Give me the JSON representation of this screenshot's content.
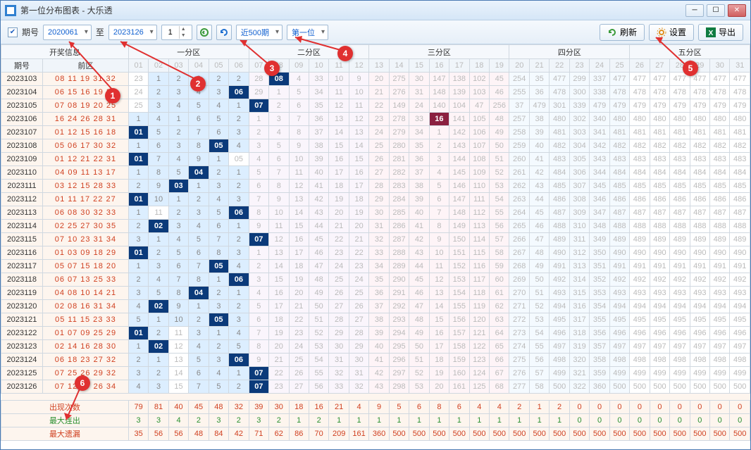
{
  "title": "第一位分布图表 - 大乐透",
  "toolbar": {
    "issue_label": "期号",
    "from": "2020061",
    "to_label": "至",
    "to": "2023126",
    "step": "1",
    "range": "近500期",
    "pos": "第一位",
    "refresh": "刷新",
    "settings": "设置",
    "export": "导出"
  },
  "header": {
    "info": "开奖信息",
    "zones": [
      "一分区",
      "二分区",
      "三分区",
      "四分区",
      "五分区"
    ],
    "issue": "期号",
    "front": "前区",
    "nums": [
      "01",
      "02",
      "03",
      "04",
      "05",
      "06",
      "07",
      "08",
      "09",
      "10",
      "11",
      "12",
      "13",
      "14",
      "15",
      "16",
      "17",
      "18",
      "19",
      "20",
      "21",
      "22",
      "23",
      "24",
      "25",
      "26",
      "27",
      "28",
      "29",
      "30",
      "31"
    ]
  },
  "rows": [
    {
      "issue": "2023103",
      "front": "08 11 19 31 32",
      "hit": 8,
      "vals": [
        23,
        1,
        2,
        3,
        2,
        2,
        28,
        "08",
        4,
        33,
        10,
        9,
        20,
        275,
        30,
        147,
        138,
        102,
        45,
        254,
        35,
        477,
        299,
        337,
        477,
        477,
        477,
        477,
        477,
        477,
        477
      ]
    },
    {
      "issue": "2023104",
      "front": "06 15 16 19 33",
      "hit": 6,
      "vals": [
        24,
        2,
        3,
        4,
        3,
        "06",
        29,
        1,
        5,
        34,
        11,
        10,
        21,
        276,
        31,
        148,
        139,
        103,
        46,
        255,
        36,
        478,
        300,
        338,
        478,
        478,
        478,
        478,
        478,
        478,
        478
      ]
    },
    {
      "issue": "2023105",
      "front": "07 08 19 20 25",
      "hit": 7,
      "vals": [
        25,
        3,
        4,
        5,
        4,
        1,
        "07",
        2,
        6,
        35,
        12,
        11,
        22,
        149,
        24,
        140,
        104,
        47,
        256,
        37,
        479,
        301,
        339,
        479,
        479,
        479,
        479,
        479,
        479,
        479,
        479
      ]
    },
    {
      "issue": "2023106",
      "front": "16 24 26 28 31",
      "hit": 16,
      "hit2": true,
      "vals": [
        1,
        4,
        1,
        6,
        5,
        2,
        1,
        3,
        7,
        36,
        13,
        12,
        23,
        278,
        33,
        "16",
        141,
        105,
        48,
        257,
        38,
        480,
        302,
        340,
        480,
        480,
        480,
        480,
        480,
        480,
        480
      ]
    },
    {
      "issue": "2023107",
      "front": "01 12 15 16 18",
      "hit": 1,
      "vals": [
        "01",
        5,
        2,
        7,
        6,
        3,
        2,
        4,
        8,
        37,
        14,
        13,
        24,
        279,
        34,
        1,
        142,
        106,
        49,
        258,
        39,
        481,
        303,
        341,
        481,
        481,
        481,
        481,
        481,
        481,
        481
      ]
    },
    {
      "issue": "2023108",
      "front": "05 06 17 30 32",
      "hit": 5,
      "vals": [
        1,
        6,
        3,
        8,
        "05",
        4,
        3,
        5,
        9,
        38,
        15,
        14,
        25,
        280,
        35,
        2,
        143,
        107,
        50,
        259,
        40,
        482,
        304,
        342,
        482,
        482,
        482,
        482,
        482,
        482,
        482
      ]
    },
    {
      "issue": "2023109",
      "front": "01 12 21 22 31",
      "hit": 1,
      "vals": [
        "01",
        7,
        4,
        9,
        1,
        "05",
        4,
        6,
        10,
        39,
        16,
        15,
        26,
        281,
        36,
        3,
        144,
        108,
        51,
        260,
        41,
        483,
        305,
        343,
        483,
        483,
        483,
        483,
        483,
        483,
        483
      ]
    },
    {
      "issue": "2023110",
      "front": "04 09 11 13 17",
      "hit": 4,
      "vals": [
        1,
        8,
        5,
        "04",
        2,
        1,
        5,
        7,
        11,
        40,
        17,
        16,
        27,
        282,
        37,
        4,
        145,
        109,
        52,
        261,
        42,
        484,
        306,
        344,
        484,
        484,
        484,
        484,
        484,
        484,
        484
      ]
    },
    {
      "issue": "2023111",
      "front": "03 12 15 28 33",
      "hit": 3,
      "vals": [
        2,
        9,
        "03",
        1,
        3,
        2,
        6,
        8,
        12,
        41,
        18,
        17,
        28,
        283,
        38,
        5,
        146,
        110,
        53,
        262,
        43,
        485,
        307,
        345,
        485,
        485,
        485,
        485,
        485,
        485,
        485
      ]
    },
    {
      "issue": "2023112",
      "front": "01 11 17 22 27",
      "hit": 1,
      "vals": [
        "01",
        10,
        1,
        2,
        4,
        3,
        7,
        9,
        13,
        42,
        19,
        18,
        29,
        284,
        39,
        6,
        147,
        111,
        54,
        263,
        44,
        486,
        308,
        346,
        486,
        486,
        486,
        486,
        486,
        486,
        486
      ]
    },
    {
      "issue": "2023113",
      "front": "06 08 30 32 33",
      "hit": 6,
      "vals": [
        1,
        11,
        2,
        3,
        5,
        "06",
        8,
        10,
        14,
        43,
        20,
        19,
        30,
        285,
        40,
        7,
        148,
        112,
        55,
        264,
        45,
        487,
        309,
        347,
        487,
        487,
        487,
        487,
        487,
        487,
        487
      ]
    },
    {
      "issue": "2023114",
      "front": "02 25 27 30 35",
      "hit": 2,
      "vals": [
        2,
        "02",
        3,
        4,
        6,
        1,
        9,
        11,
        15,
        44,
        21,
        20,
        31,
        286,
        41,
        8,
        149,
        113,
        56,
        265,
        46,
        488,
        310,
        348,
        488,
        488,
        488,
        488,
        488,
        488,
        488
      ]
    },
    {
      "issue": "2023115",
      "front": "07 10 23 31 34",
      "hit": 7,
      "vals": [
        3,
        1,
        4,
        5,
        7,
        2,
        "07",
        12,
        16,
        45,
        22,
        21,
        32,
        287,
        42,
        9,
        150,
        114,
        57,
        266,
        47,
        489,
        311,
        349,
        489,
        489,
        489,
        489,
        489,
        489,
        489
      ]
    },
    {
      "issue": "2023116",
      "front": "01 03 09 18 29",
      "hit": 1,
      "vals": [
        "01",
        2,
        5,
        6,
        8,
        3,
        1,
        13,
        17,
        46,
        23,
        22,
        33,
        288,
        43,
        10,
        151,
        115,
        58,
        267,
        48,
        490,
        312,
        350,
        490,
        490,
        490,
        490,
        490,
        490,
        490
      ]
    },
    {
      "issue": "2023117",
      "front": "05 07 15 18 20",
      "hit": 5,
      "vals": [
        1,
        3,
        6,
        7,
        "05",
        4,
        2,
        14,
        18,
        47,
        24,
        23,
        34,
        289,
        44,
        11,
        152,
        116,
        59,
        268,
        49,
        491,
        313,
        351,
        491,
        491,
        491,
        491,
        491,
        491,
        491
      ]
    },
    {
      "issue": "2023118",
      "front": "06 07 13 25 33",
      "hit": 6,
      "vals": [
        2,
        4,
        7,
        8,
        1,
        "06",
        3,
        15,
        19,
        48,
        25,
        24,
        35,
        290,
        45,
        12,
        153,
        117,
        60,
        269,
        50,
        492,
        314,
        352,
        492,
        492,
        492,
        492,
        492,
        492,
        492
      ]
    },
    {
      "issue": "2023119",
      "front": "04 08 10 14 21",
      "hit": 4,
      "vals": [
        3,
        5,
        8,
        "04",
        2,
        1,
        4,
        16,
        20,
        49,
        26,
        25,
        36,
        291,
        46,
        13,
        154,
        118,
        61,
        270,
        51,
        493,
        315,
        353,
        493,
        493,
        493,
        493,
        493,
        493,
        493
      ]
    },
    {
      "issue": "2023120",
      "front": "02 08 16 31 34",
      "hit": 2,
      "vals": [
        4,
        "02",
        9,
        1,
        3,
        2,
        5,
        17,
        21,
        50,
        27,
        26,
        37,
        292,
        47,
        14,
        155,
        119,
        62,
        271,
        52,
        494,
        316,
        354,
        494,
        494,
        494,
        494,
        494,
        494,
        494
      ]
    },
    {
      "issue": "2023121",
      "front": "05 11 15 23 33",
      "hit": 5,
      "vals": [
        5,
        1,
        10,
        2,
        "05",
        3,
        6,
        18,
        22,
        51,
        28,
        27,
        38,
        293,
        48,
        15,
        156,
        120,
        63,
        272,
        53,
        495,
        317,
        355,
        495,
        495,
        495,
        495,
        495,
        495,
        495
      ]
    },
    {
      "issue": "2023122",
      "front": "01 07 09 25 29",
      "hit": 1,
      "vals": [
        "01",
        2,
        11,
        3,
        1,
        4,
        7,
        19,
        23,
        52,
        29,
        28,
        39,
        294,
        49,
        16,
        157,
        121,
        64,
        273,
        54,
        496,
        318,
        356,
        496,
        496,
        496,
        496,
        496,
        496,
        496
      ]
    },
    {
      "issue": "2023123",
      "front": "02 14 16 28 30",
      "hit": 2,
      "vals": [
        1,
        "02",
        12,
        4,
        2,
        5,
        8,
        20,
        24,
        53,
        30,
        29,
        40,
        295,
        50,
        17,
        158,
        122,
        65,
        274,
        55,
        497,
        319,
        357,
        497,
        497,
        497,
        497,
        497,
        497,
        497
      ]
    },
    {
      "issue": "2023124",
      "front": "06 18 23 27 32",
      "hit": 6,
      "vals": [
        2,
        1,
        13,
        5,
        3,
        "06",
        9,
        21,
        25,
        54,
        31,
        30,
        41,
        296,
        51,
        18,
        159,
        123,
        66,
        275,
        56,
        498,
        320,
        358,
        498,
        498,
        498,
        498,
        498,
        498,
        498
      ]
    },
    {
      "issue": "2023125",
      "front": "07 25 26 29 32",
      "hit": 7,
      "vals": [
        3,
        2,
        14,
        6,
        4,
        1,
        "07",
        22,
        26,
        55,
        32,
        31,
        42,
        297,
        52,
        19,
        160,
        124,
        67,
        276,
        57,
        499,
        321,
        359,
        499,
        499,
        499,
        499,
        499,
        499,
        499
      ]
    },
    {
      "issue": "2023126",
      "front": "07 12 17 26 34",
      "hit": 7,
      "vals": [
        4,
        3,
        15,
        7,
        5,
        2,
        "07",
        23,
        27,
        56,
        33,
        32,
        43,
        298,
        53,
        20,
        161,
        125,
        68,
        277,
        58,
        500,
        322,
        360,
        500,
        500,
        500,
        500,
        500,
        500,
        500
      ]
    }
  ],
  "stats": {
    "appear_label": "出现次数",
    "appear": [
      79,
      81,
      40,
      45,
      48,
      32,
      39,
      30,
      18,
      16,
      21,
      4,
      9,
      5,
      6,
      8,
      6,
      4,
      4,
      2,
      1,
      2,
      0,
      0,
      0,
      0,
      0,
      0,
      0,
      0,
      0
    ],
    "maxrun_label": "最大连出",
    "maxrun": [
      3,
      3,
      4,
      2,
      3,
      2,
      3,
      2,
      1,
      2,
      1,
      1,
      1,
      1,
      1,
      1,
      1,
      1,
      1,
      1,
      1,
      1,
      0,
      0,
      0,
      0,
      0,
      0,
      0,
      0,
      0
    ],
    "maxmiss_label": "最大遗漏",
    "maxmiss": [
      35,
      56,
      56,
      48,
      84,
      42,
      71,
      62,
      86,
      70,
      209,
      161,
      360,
      500,
      500,
      500,
      500,
      500,
      500,
      500,
      500,
      500,
      500,
      500,
      500,
      500,
      500,
      500,
      500,
      500,
      500
    ]
  },
  "markers": [
    "1",
    "2",
    "3",
    "4",
    "5",
    "6"
  ]
}
